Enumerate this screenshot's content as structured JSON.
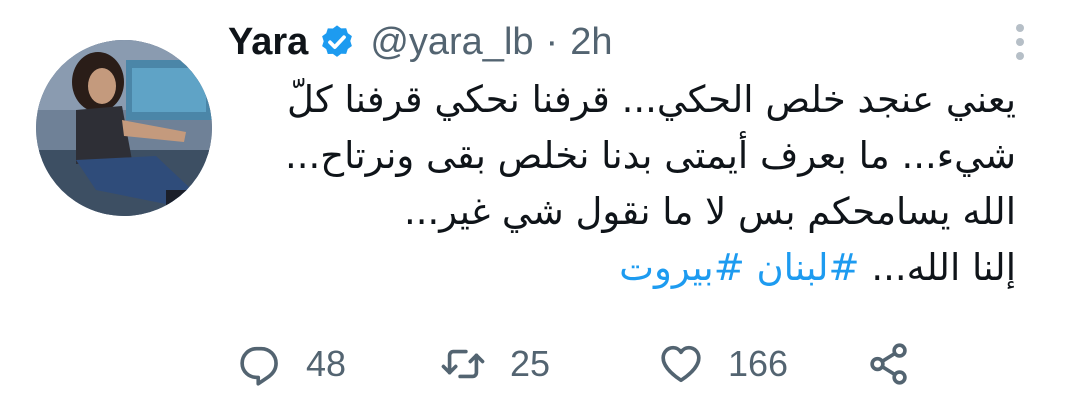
{
  "tweet": {
    "author": {
      "display_name": "Yara",
      "handle": "@yara_lb",
      "verified": true
    },
    "separator": "·",
    "time": "2h",
    "body_lines": [
      "يعني عنجد خلص الحكي... قرفنا نحكي قرفنا كلّ",
      "شيء... ما بعرف أيمتى بدنا نخلص بقى ونرتاح...",
      "الله يسامحكم بس لا ما نقول شي غير..."
    ],
    "last_line_text": "إلنا الله...",
    "hashtags": [
      "#لبنان",
      "#بيروت"
    ]
  },
  "actions": {
    "reply": {
      "icon": "reply-icon",
      "count": "48"
    },
    "retweet": {
      "icon": "retweet-icon",
      "count": "25"
    },
    "like": {
      "icon": "heart-icon",
      "count": "166"
    },
    "share": {
      "icon": "share-icon"
    }
  },
  "colors": {
    "text": "#0f1419",
    "secondary": "#536471",
    "link": "#1d9bf0",
    "verified": "#1d9bf0"
  }
}
